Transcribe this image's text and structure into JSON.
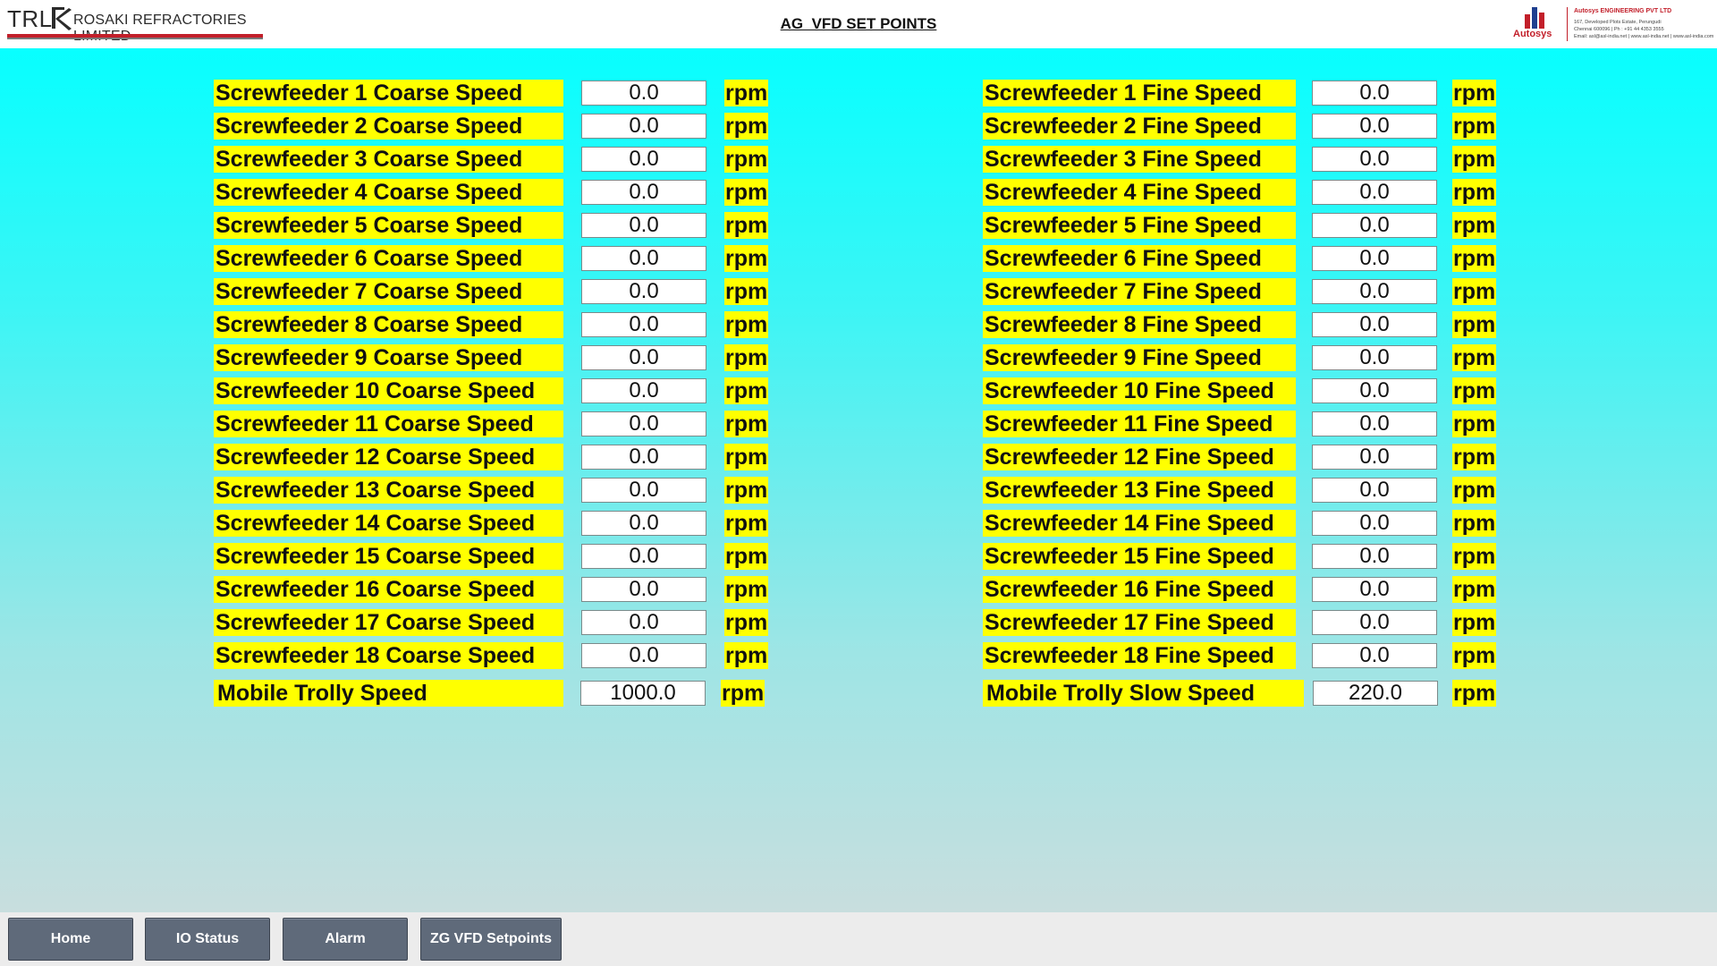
{
  "header": {
    "logo_trl": "TRL",
    "logo_company": "ROSAKI REFRACTORIES LIMITED",
    "title": "AG  VFD SET POINTS",
    "autosys": {
      "brand": "Autosys",
      "company": "Autosys ENGINEERING PVT LTD",
      "address1": "167, Developed Plots Estate, Perungudi",
      "address2": "Chennai 600096 | Ph : +91 44 4353 3555",
      "address3": "Email: asl@asl-india.net | www.asl-india.net | www.asl-india.com"
    }
  },
  "colors": {
    "background_top": "#07ffff",
    "background_bottom": "#c8dede",
    "label_bg": "#ffff00",
    "nav_button": "#5f6a7a",
    "logo_red": "#c21f2a"
  },
  "coarse": [
    {
      "label": "Screwfeeder 1 Coarse Speed",
      "value": "0.0",
      "unit": "rpm"
    },
    {
      "label": "Screwfeeder 2 Coarse Speed",
      "value": "0.0",
      "unit": "rpm"
    },
    {
      "label": "Screwfeeder 3 Coarse Speed",
      "value": "0.0",
      "unit": "rpm"
    },
    {
      "label": "Screwfeeder 4 Coarse Speed",
      "value": "0.0",
      "unit": "rpm"
    },
    {
      "label": "Screwfeeder 5 Coarse Speed",
      "value": "0.0",
      "unit": "rpm"
    },
    {
      "label": "Screwfeeder 6 Coarse Speed",
      "value": "0.0",
      "unit": "rpm"
    },
    {
      "label": "Screwfeeder 7 Coarse Speed",
      "value": "0.0",
      "unit": "rpm"
    },
    {
      "label": "Screwfeeder 8 Coarse Speed",
      "value": "0.0",
      "unit": "rpm"
    },
    {
      "label": "Screwfeeder 9 Coarse Speed",
      "value": "0.0",
      "unit": "rpm"
    },
    {
      "label": "Screwfeeder 10 Coarse Speed",
      "value": "0.0",
      "unit": "rpm"
    },
    {
      "label": "Screwfeeder 11 Coarse Speed",
      "value": "0.0",
      "unit": "rpm"
    },
    {
      "label": "Screwfeeder 12 Coarse Speed",
      "value": "0.0",
      "unit": "rpm"
    },
    {
      "label": "Screwfeeder 13 Coarse Speed",
      "value": "0.0",
      "unit": "rpm"
    },
    {
      "label": "Screwfeeder 14 Coarse Speed",
      "value": "0.0",
      "unit": "rpm"
    },
    {
      "label": "Screwfeeder 15 Coarse Speed",
      "value": "0.0",
      "unit": "rpm"
    },
    {
      "label": "Screwfeeder 16 Coarse Speed",
      "value": "0.0",
      "unit": "rpm"
    },
    {
      "label": "Screwfeeder 17 Coarse Speed",
      "value": "0.0",
      "unit": "rpm"
    },
    {
      "label": "Screwfeeder 18 Coarse Speed",
      "value": "0.0",
      "unit": "rpm"
    },
    {
      "label": "Mobile Trolly Speed",
      "value": "1000.0",
      "unit": "rpm"
    }
  ],
  "fine": [
    {
      "label": "Screwfeeder 1 Fine Speed",
      "value": "0.0",
      "unit": "rpm"
    },
    {
      "label": "Screwfeeder 2 Fine Speed",
      "value": "0.0",
      "unit": "rpm"
    },
    {
      "label": "Screwfeeder 3 Fine Speed",
      "value": "0.0",
      "unit": "rpm"
    },
    {
      "label": "Screwfeeder 4 Fine Speed",
      "value": "0.0",
      "unit": "rpm"
    },
    {
      "label": "Screwfeeder 5 Fine Speed",
      "value": "0.0",
      "unit": "rpm"
    },
    {
      "label": "Screwfeeder 6 Fine Speed",
      "value": "0.0",
      "unit": "rpm"
    },
    {
      "label": "Screwfeeder 7 Fine Speed",
      "value": "0.0",
      "unit": "rpm"
    },
    {
      "label": "Screwfeeder 8 Fine Speed",
      "value": "0.0",
      "unit": "rpm"
    },
    {
      "label": "Screwfeeder 9 Fine Speed",
      "value": "0.0",
      "unit": "rpm"
    },
    {
      "label": "Screwfeeder 10 Fine Speed",
      "value": "0.0",
      "unit": "rpm"
    },
    {
      "label": "Screwfeeder 11 Fine Speed",
      "value": "0.0",
      "unit": "rpm"
    },
    {
      "label": "Screwfeeder 12 Fine Speed",
      "value": "0.0",
      "unit": "rpm"
    },
    {
      "label": "Screwfeeder 13 Fine Speed",
      "value": "0.0",
      "unit": "rpm"
    },
    {
      "label": "Screwfeeder 14 Fine Speed",
      "value": "0.0",
      "unit": "rpm"
    },
    {
      "label": "Screwfeeder 15 Fine Speed",
      "value": "0.0",
      "unit": "rpm"
    },
    {
      "label": "Screwfeeder 16 Fine Speed",
      "value": "0.0",
      "unit": "rpm"
    },
    {
      "label": "Screwfeeder 17 Fine Speed",
      "value": "0.0",
      "unit": "rpm"
    },
    {
      "label": "Screwfeeder 18 Fine Speed",
      "value": "0.0",
      "unit": "rpm"
    },
    {
      "label": "Mobile Trolly Slow Speed",
      "value": "220.0",
      "unit": "rpm"
    }
  ],
  "nav": [
    {
      "label": "Home",
      "name": "home"
    },
    {
      "label": "IO Status",
      "name": "io-status"
    },
    {
      "label": "Alarm",
      "name": "alarm"
    },
    {
      "label": "ZG VFD Setpoints",
      "name": "zg-vfd-setpoints"
    }
  ]
}
